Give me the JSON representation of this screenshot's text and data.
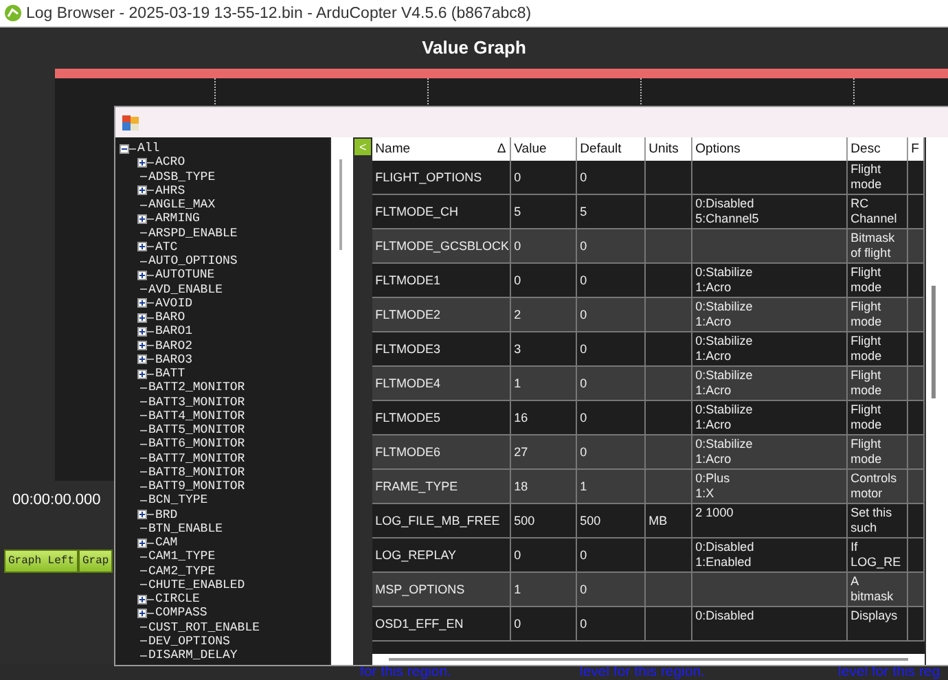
{
  "window": {
    "title": "Log Browser - 2025-03-19 13-55-12.bin - ArduCopter V4.5.6 (b867abc8)"
  },
  "graph": {
    "title": "Value Graph",
    "time": "00:00:00.000",
    "buttons": [
      "Graph Left",
      "Grap"
    ],
    "bottom_texts": [
      "for this region.",
      "level for this region.",
      "level for this reg"
    ]
  },
  "dialog": {
    "collapse_button": "<",
    "tree": {
      "label": "All",
      "expanded": true,
      "children": [
        {
          "label": "ACRO",
          "kind": "group",
          "expanded": false
        },
        {
          "label": "ADSB_TYPE",
          "kind": "leaf"
        },
        {
          "label": "AHRS",
          "kind": "group",
          "expanded": false
        },
        {
          "label": "ANGLE_MAX",
          "kind": "leaf"
        },
        {
          "label": "ARMING",
          "kind": "group",
          "expanded": false
        },
        {
          "label": "ARSPD_ENABLE",
          "kind": "leaf"
        },
        {
          "label": "ATC",
          "kind": "group",
          "expanded": false
        },
        {
          "label": "AUTO_OPTIONS",
          "kind": "leaf"
        },
        {
          "label": "AUTOTUNE",
          "kind": "group",
          "expanded": false
        },
        {
          "label": "AVD_ENABLE",
          "kind": "leaf"
        },
        {
          "label": "AVOID",
          "kind": "group",
          "expanded": false
        },
        {
          "label": "BARO",
          "kind": "group",
          "expanded": false
        },
        {
          "label": "BARO1",
          "kind": "group",
          "expanded": false
        },
        {
          "label": "BARO2",
          "kind": "group",
          "expanded": false
        },
        {
          "label": "BARO3",
          "kind": "group",
          "expanded": false
        },
        {
          "label": "BATT",
          "kind": "group",
          "expanded": false
        },
        {
          "label": "BATT2_MONITOR",
          "kind": "leaf"
        },
        {
          "label": "BATT3_MONITOR",
          "kind": "leaf"
        },
        {
          "label": "BATT4_MONITOR",
          "kind": "leaf"
        },
        {
          "label": "BATT5_MONITOR",
          "kind": "leaf"
        },
        {
          "label": "BATT6_MONITOR",
          "kind": "leaf"
        },
        {
          "label": "BATT7_MONITOR",
          "kind": "leaf"
        },
        {
          "label": "BATT8_MONITOR",
          "kind": "leaf"
        },
        {
          "label": "BATT9_MONITOR",
          "kind": "leaf"
        },
        {
          "label": "BCN_TYPE",
          "kind": "leaf"
        },
        {
          "label": "BRD",
          "kind": "group",
          "expanded": false
        },
        {
          "label": "BTN_ENABLE",
          "kind": "leaf"
        },
        {
          "label": "CAM",
          "kind": "group",
          "expanded": false
        },
        {
          "label": "CAM1_TYPE",
          "kind": "leaf"
        },
        {
          "label": "CAM2_TYPE",
          "kind": "leaf"
        },
        {
          "label": "CHUTE_ENABLED",
          "kind": "leaf"
        },
        {
          "label": "CIRCLE",
          "kind": "group",
          "expanded": false
        },
        {
          "label": "COMPASS",
          "kind": "group",
          "expanded": false
        },
        {
          "label": "CUST_ROT_ENABLE",
          "kind": "leaf"
        },
        {
          "label": "DEV_OPTIONS",
          "kind": "leaf"
        },
        {
          "label": "DISARM_DELAY",
          "kind": "leaf"
        }
      ]
    },
    "table": {
      "columns": [
        "Name",
        "Value",
        "Default",
        "Units",
        "Options",
        "Desc",
        "F"
      ],
      "sort_indicator": "Δ",
      "rows": [
        {
          "name": "FLIGHT_OPTIONS",
          "value": "0",
          "default": "0",
          "desc": [
            "Flight",
            "mode"
          ],
          "shaded": false
        },
        {
          "name": "FLTMODE_CH",
          "value": "5",
          "default": "5",
          "options": [
            "0:Disabled",
            "5:Channel5"
          ],
          "desc": [
            "RC",
            "Channel"
          ],
          "shaded": false
        },
        {
          "name": "FLTMODE_GCSBLOCK",
          "value": "0",
          "default": "0",
          "desc": [
            "Bitmask",
            "of flight"
          ],
          "shaded": true
        },
        {
          "name": "FLTMODE1",
          "value": "0",
          "default": "0",
          "options": [
            "0:Stabilize",
            "1:Acro"
          ],
          "desc": [
            "Flight",
            "mode"
          ],
          "shaded": false
        },
        {
          "name": "FLTMODE2",
          "value": "2",
          "default": "0",
          "options": [
            "0:Stabilize",
            "1:Acro"
          ],
          "desc": [
            "Flight",
            "mode"
          ],
          "shaded": true
        },
        {
          "name": "FLTMODE3",
          "value": "3",
          "default": "0",
          "options": [
            "0:Stabilize",
            "1:Acro"
          ],
          "desc": [
            "Flight",
            "mode"
          ],
          "shaded": false
        },
        {
          "name": "FLTMODE4",
          "value": "1",
          "default": "0",
          "options": [
            "0:Stabilize",
            "1:Acro"
          ],
          "desc": [
            "Flight",
            "mode"
          ],
          "shaded": true
        },
        {
          "name": "FLTMODE5",
          "value": "16",
          "default": "0",
          "options": [
            "0:Stabilize",
            "1:Acro"
          ],
          "desc": [
            "Flight",
            "mode"
          ],
          "shaded": false
        },
        {
          "name": "FLTMODE6",
          "value": "27",
          "default": "0",
          "options": [
            "0:Stabilize",
            "1:Acro"
          ],
          "desc": [
            "Flight",
            "mode"
          ],
          "shaded": true
        },
        {
          "name": "FRAME_TYPE",
          "value": "18",
          "default": "1",
          "options": [
            "0:Plus",
            "1:X"
          ],
          "desc": [
            "Controls",
            "motor"
          ],
          "shaded": true
        },
        {
          "name": "LOG_FILE_MB_FREE",
          "value": "500",
          "default": "500",
          "units": "MB",
          "options": [
            "2 1000"
          ],
          "desc": [
            "Set this",
            "such"
          ],
          "shaded": false
        },
        {
          "name": "LOG_REPLAY",
          "value": "0",
          "default": "0",
          "options": [
            "0:Disabled",
            "1:Enabled"
          ],
          "desc": [
            "If",
            "LOG_RE"
          ],
          "shaded": false
        },
        {
          "name": "MSP_OPTIONS",
          "value": "1",
          "default": "0",
          "desc": [
            "A",
            "bitmask"
          ],
          "shaded": true
        },
        {
          "name": "OSD1_EFF_EN",
          "value": "0",
          "default": "0",
          "options": [
            "0:Disabled"
          ],
          "desc": [
            "Displays"
          ],
          "shaded": false
        }
      ]
    }
  }
}
